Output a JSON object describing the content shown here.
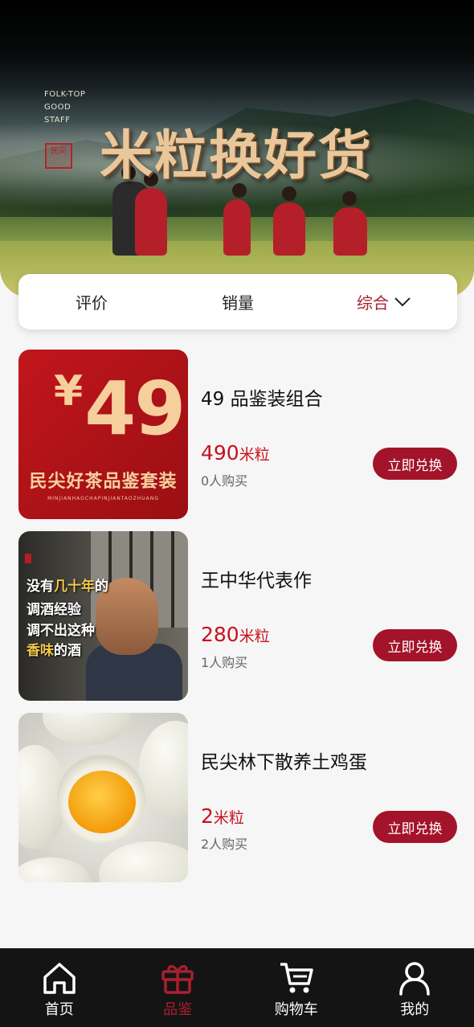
{
  "banner": {
    "brand_lines": [
      "FOLK-TOP",
      "GOOD",
      "STAFF"
    ],
    "seal_text": "民尖",
    "title": "米粒换好货"
  },
  "sort": {
    "items": [
      {
        "label": "评价",
        "active": false
      },
      {
        "label": "销量",
        "active": false
      },
      {
        "label": "综合",
        "active": true,
        "icon": "chevron-down-icon"
      }
    ]
  },
  "products": [
    {
      "name": "49 品鉴装组合",
      "price": "490",
      "unit": "米粒",
      "sold": "0人购买",
      "button": "立即兑换",
      "thumb": {
        "price_text": "49",
        "yen": "¥",
        "subtitle": "民尖好茶品鉴套装",
        "tiny": "MINJIANHAOCHAPINJIANTAOZHUANG"
      }
    },
    {
      "name": "王中华代表作",
      "price": "280",
      "unit": "米粒",
      "sold": "1人购买",
      "button": "立即兑换",
      "thumb": {
        "lines": [
          {
            "pre": "没有",
            "hl": "几十年",
            "post": "的"
          },
          {
            "pre": "调酒经验",
            "hl": "",
            "post": ""
          },
          {
            "pre": "调不出这种",
            "hl": "",
            "post": ""
          },
          {
            "pre": "",
            "hl": "香味",
            "post": "的酒"
          }
        ]
      }
    },
    {
      "name": "民尖林下散养土鸡蛋",
      "price": "2",
      "unit": "米粒",
      "sold": "2人购买",
      "button": "立即兑换"
    }
  ],
  "nav": {
    "items": [
      {
        "label": "首页",
        "icon": "home-icon",
        "active": false
      },
      {
        "label": "品鉴",
        "icon": "gift-icon",
        "active": true
      },
      {
        "label": "购物车",
        "icon": "cart-icon",
        "active": false
      },
      {
        "label": "我的",
        "icon": "user-icon",
        "active": false
      }
    ]
  },
  "colors": {
    "accent": "#a8202e",
    "price": "#c8101e",
    "button": "#a3132a",
    "navbar": "#141414"
  }
}
